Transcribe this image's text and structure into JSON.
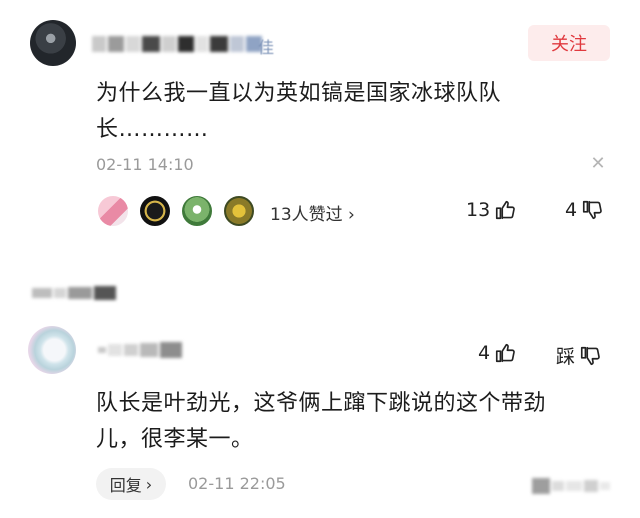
{
  "comment1": {
    "avatar_icon": "user-avatar",
    "username_obscured": true,
    "username_visible_tail": "佳",
    "follow_label": "关注",
    "text_line1": "为什么我一直以为英如镐是国家冰球队队",
    "text_line2": "长…………",
    "timestamp": "02-11 14:10",
    "close_icon": "close-icon",
    "likers_label": "13人赞过 ›",
    "like_count": "13",
    "dislike_count": "4",
    "colors": {
      "follow_bg": "#fdecec",
      "follow_text": "#e0393e"
    }
  },
  "comment2": {
    "avatar_icon": "user-avatar",
    "username_obscured": true,
    "like_count": "4",
    "dislike_label": "踩",
    "text_line1": "队长是叶劲光，这爷俩上蹿下跳说的这个带劲",
    "text_line2": "儿，很李某一。",
    "reply_label": "回复",
    "timestamp": "02-11 22:05"
  }
}
